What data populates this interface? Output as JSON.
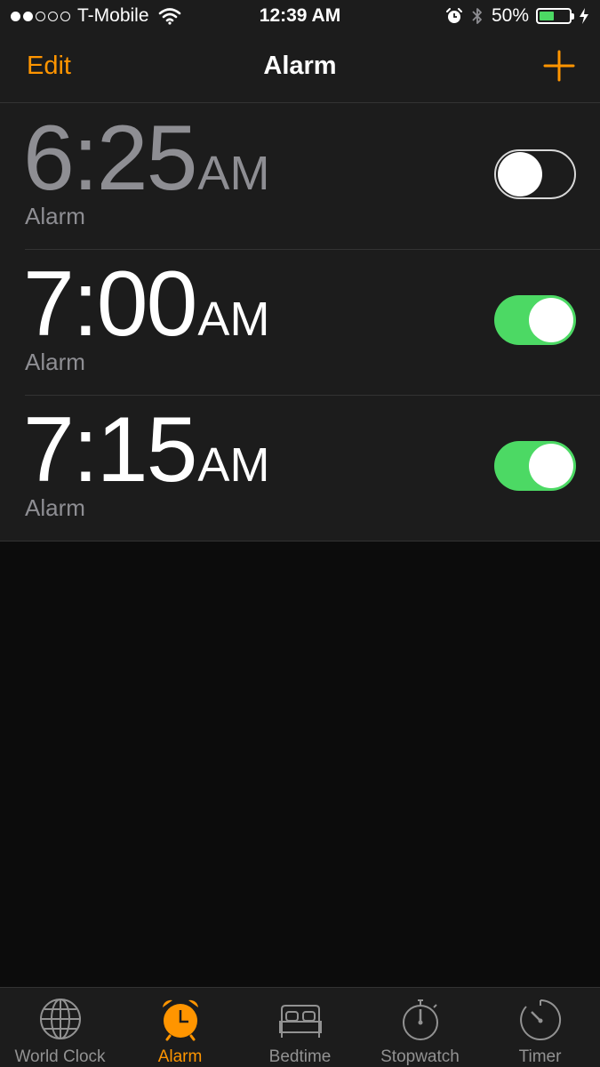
{
  "status_bar": {
    "carrier": "T-Mobile",
    "signal_strength": 2,
    "time": "12:39 AM",
    "battery": "50%",
    "battery_level": 0.5
  },
  "nav": {
    "edit_label": "Edit",
    "title": "Alarm",
    "add_icon": "plus-icon"
  },
  "alarms": [
    {
      "time": "6:25",
      "period": "AM",
      "label": "Alarm",
      "enabled": false
    },
    {
      "time": "7:00",
      "period": "AM",
      "label": "Alarm",
      "enabled": true
    },
    {
      "time": "7:15",
      "period": "AM",
      "label": "Alarm",
      "enabled": true
    }
  ],
  "tabs": [
    {
      "label": "World Clock",
      "icon": "globe-icon",
      "active": false
    },
    {
      "label": "Alarm",
      "icon": "alarm-clock-icon",
      "active": true
    },
    {
      "label": "Bedtime",
      "icon": "bed-icon",
      "active": false
    },
    {
      "label": "Stopwatch",
      "icon": "stopwatch-icon",
      "active": false
    },
    {
      "label": "Timer",
      "icon": "timer-icon",
      "active": false
    }
  ],
  "colors": {
    "accent": "#ff9500",
    "toggle_on": "#4cd964",
    "secondary_text": "#8e8e93",
    "background": "#0c0c0c",
    "panel": "#1c1c1c"
  }
}
